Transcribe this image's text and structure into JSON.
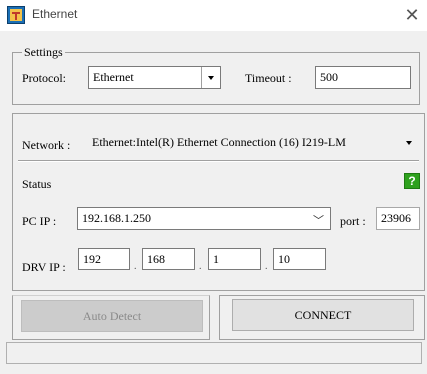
{
  "window": {
    "title": "Ethernet",
    "icon": "app-icon",
    "close_glyph": "✕"
  },
  "settings": {
    "group_label": "Settings",
    "protocol_label": "Protocol:",
    "protocol_value": "Ethernet",
    "timeout_label": "Timeout :",
    "timeout_value": "500"
  },
  "network": {
    "label": "Network :",
    "value": "Ethernet:Intel(R) Ethernet Connection (16) I219-LM"
  },
  "status": {
    "label": "Status",
    "indicator": "?",
    "indicator_color": "#2ea11d"
  },
  "pc_ip": {
    "label": "PC IP :",
    "value": "192.168.1.250",
    "port_label": "port :",
    "port_value": "23906"
  },
  "drv_ip": {
    "label": "DRV IP :",
    "octets": [
      "192",
      "168",
      "1",
      "10"
    ],
    "separator": "."
  },
  "buttons": {
    "auto_detect": "Auto Detect",
    "connect": "CONNECT"
  },
  "colors": {
    "window_bg": "#f0f0f0",
    "status_green": "#2ea11d"
  }
}
